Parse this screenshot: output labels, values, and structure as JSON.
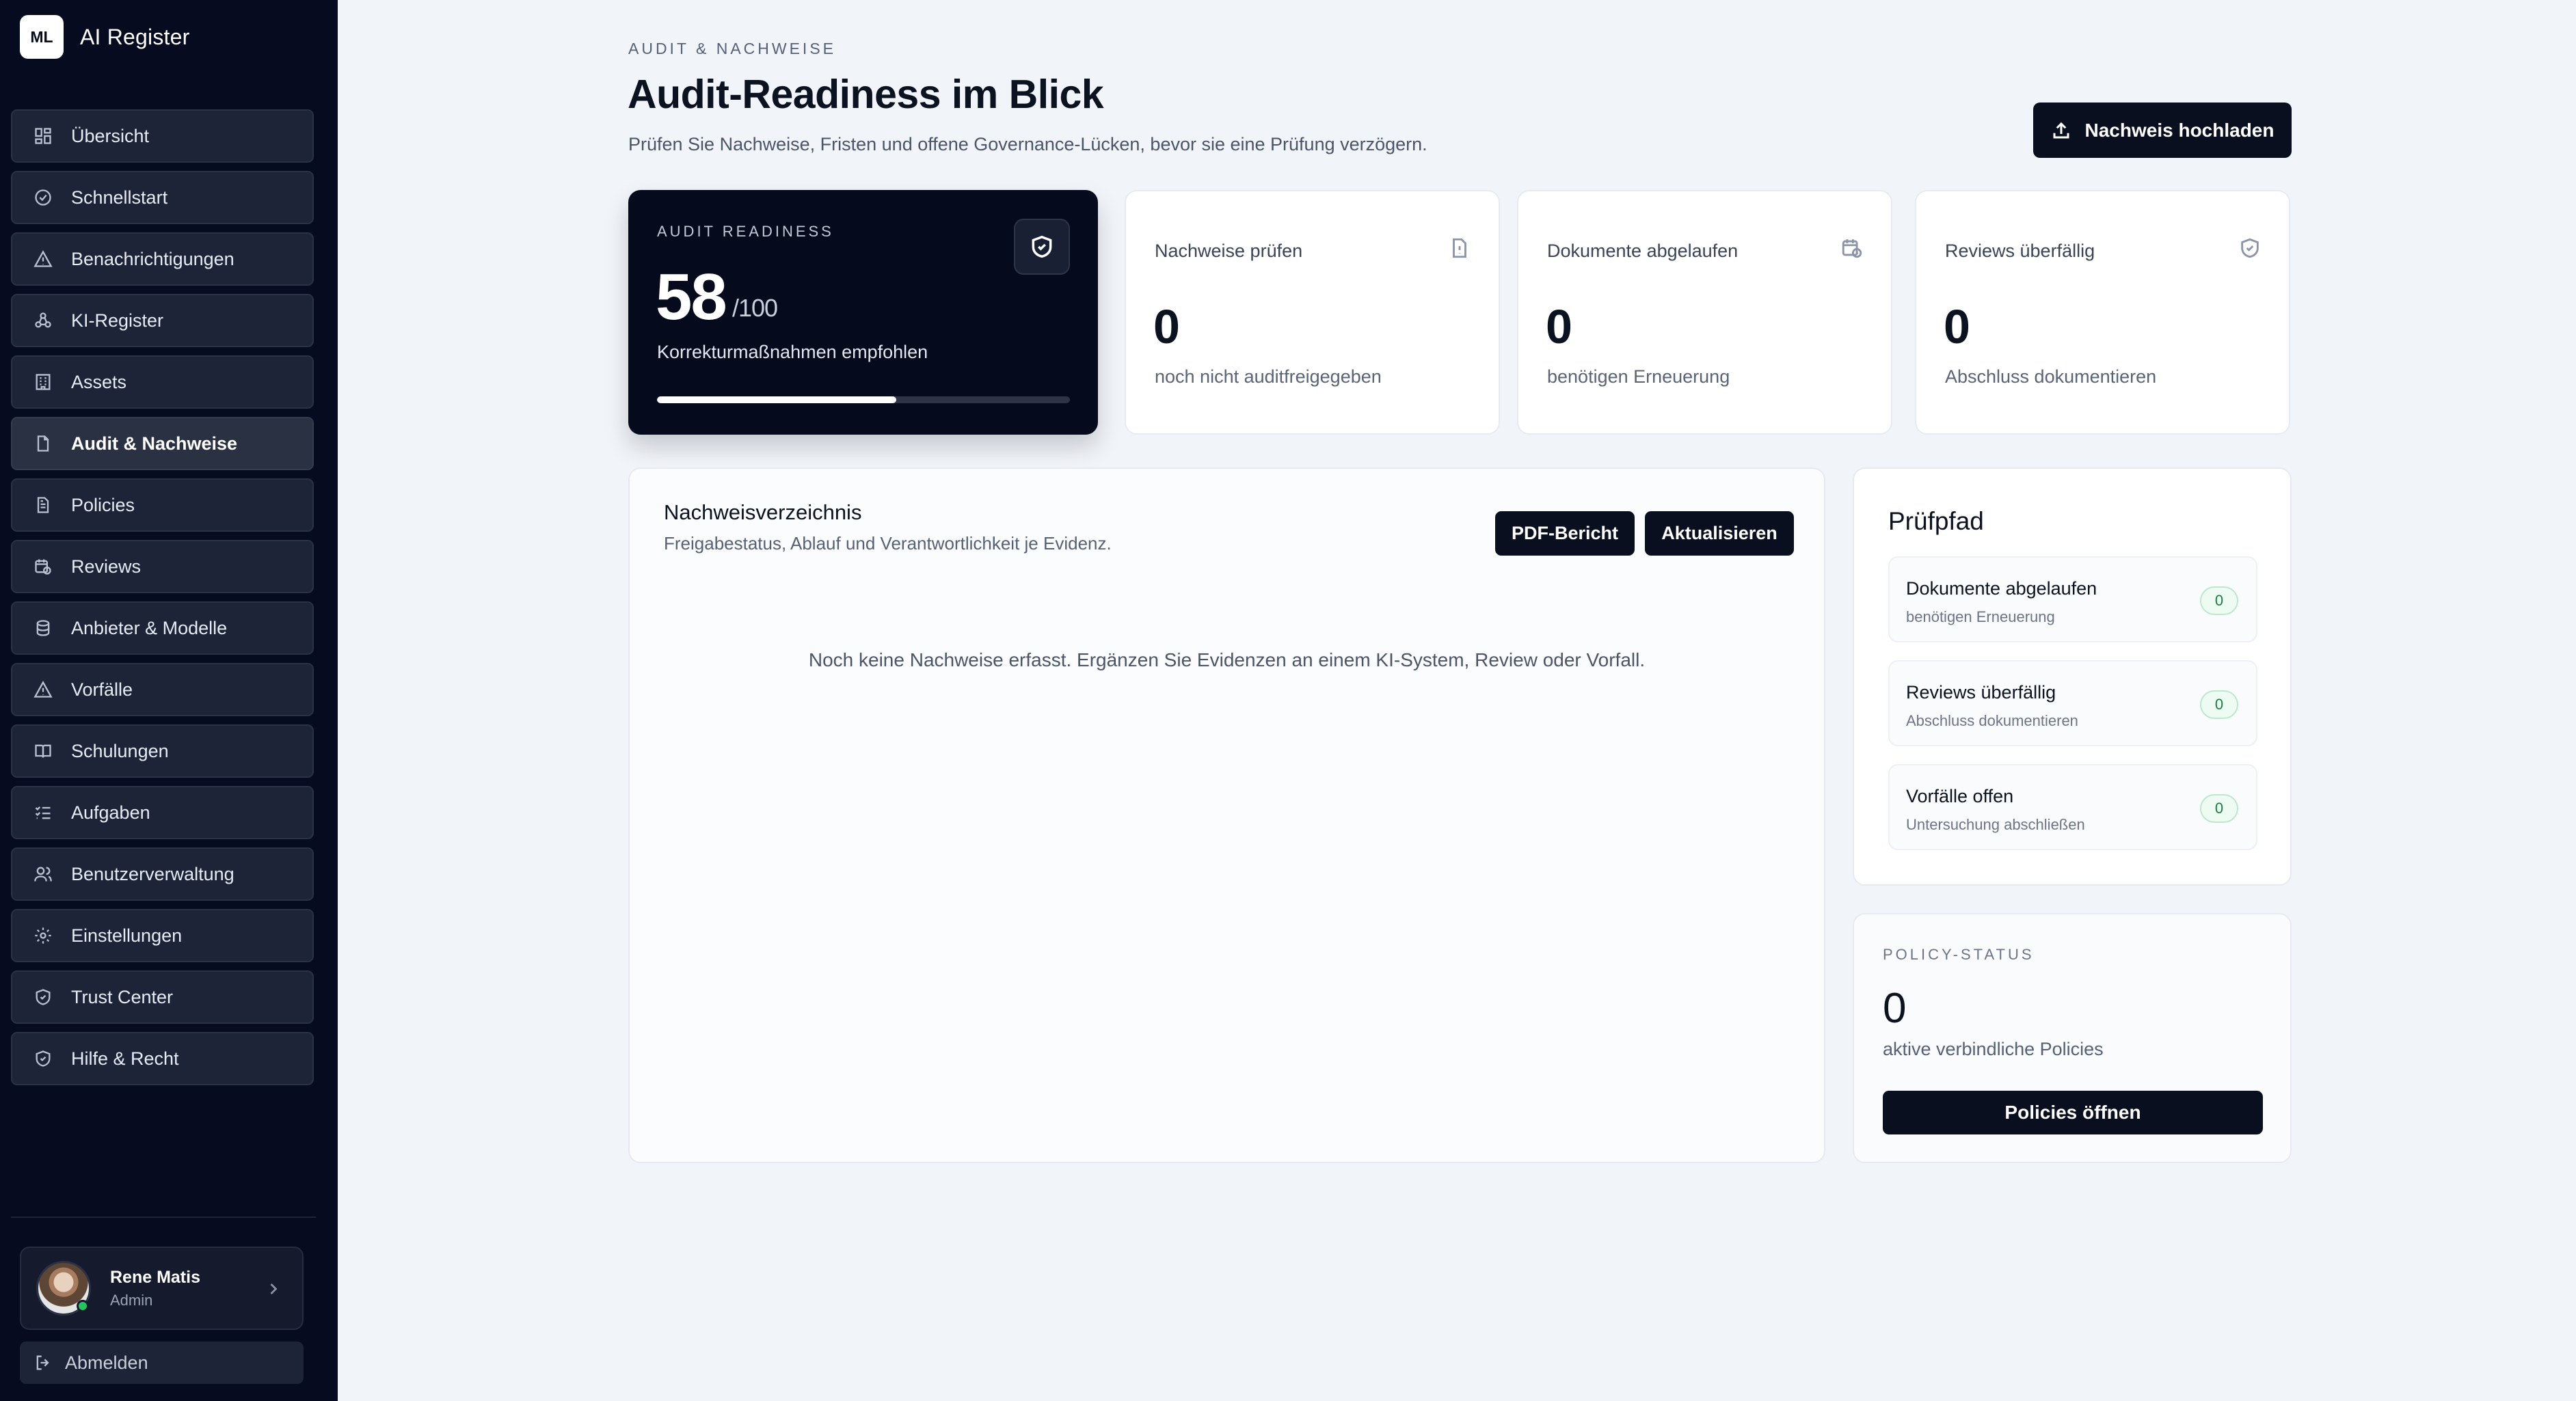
{
  "app": {
    "logo_text": "ML",
    "name": "AI Register"
  },
  "sidebar": {
    "items": [
      {
        "label": "Übersicht",
        "icon": "grid-icon",
        "active": false
      },
      {
        "label": "Schnellstart",
        "icon": "check-circle-icon",
        "active": false
      },
      {
        "label": "Benachrichtigungen",
        "icon": "alert-triangle-icon",
        "active": false
      },
      {
        "label": "KI-Register",
        "icon": "network-icon",
        "active": false
      },
      {
        "label": "Assets",
        "icon": "building-icon",
        "active": false
      },
      {
        "label": "Audit & Nachweise",
        "icon": "file-icon",
        "active": true
      },
      {
        "label": "Policies",
        "icon": "document-icon",
        "active": false
      },
      {
        "label": "Reviews",
        "icon": "calendar-clock-icon",
        "active": false
      },
      {
        "label": "Anbieter & Modelle",
        "icon": "database-icon",
        "active": false
      },
      {
        "label": "Vorfälle",
        "icon": "alert-triangle-icon",
        "active": false
      },
      {
        "label": "Schulungen",
        "icon": "book-open-icon",
        "active": false
      },
      {
        "label": "Aufgaben",
        "icon": "list-checks-icon",
        "active": false
      },
      {
        "label": "Benutzerverwaltung",
        "icon": "users-icon",
        "active": false
      },
      {
        "label": "Einstellungen",
        "icon": "gear-icon",
        "active": false
      },
      {
        "label": "Trust Center",
        "icon": "shield-check-icon",
        "active": false
      },
      {
        "label": "Hilfe & Recht",
        "icon": "shield-icon",
        "active": false
      }
    ],
    "user": {
      "name": "Rene Matis",
      "role": "Admin",
      "online": true
    },
    "logout_label": "Abmelden"
  },
  "header": {
    "eyebrow": "AUDIT & NACHWEISE",
    "title": "Audit-Readiness im Blick",
    "subtitle": "Prüfen Sie Nachweise, Fristen und offene Governance-Lücken, bevor sie eine Prüfung verzögern.",
    "upload_label": "Nachweis hochladen"
  },
  "readiness": {
    "label": "AUDIT READINESS",
    "score": "58",
    "max": "/100",
    "note": "Korrekturmaßnahmen empfohlen",
    "progress": 0.58
  },
  "stats": [
    {
      "title": "Nachweise prüfen",
      "value": "0",
      "note": "noch nicht auditfreigegeben",
      "icon": "file-alert-icon"
    },
    {
      "title": "Dokumente abgelaufen",
      "value": "0",
      "note": "benötigen Erneuerung",
      "icon": "calendar-clock-icon"
    },
    {
      "title": "Reviews überfällig",
      "value": "0",
      "note": "Abschluss dokumentieren",
      "icon": "shield-icon"
    }
  ],
  "evidence": {
    "title": "Nachweisverzeichnis",
    "subtitle": "Freigabestatus, Ablauf und Verantwortlichkeit je Evidenz.",
    "pdf_label": "PDF-Bericht",
    "refresh_label": "Aktualisieren",
    "empty_text": "Noch keine Nachweise erfasst. Ergänzen Sie Evidenzen an einem KI-System, Review oder Vorfall."
  },
  "audit_path": {
    "title": "Prüfpfad",
    "items": [
      {
        "title": "Dokumente abgelaufen",
        "sub": "benötigen Erneuerung",
        "count": "0"
      },
      {
        "title": "Reviews überfällig",
        "sub": "Abschluss dokumentieren",
        "count": "0"
      },
      {
        "title": "Vorfälle offen",
        "sub": "Untersuchung abschließen",
        "count": "0"
      }
    ]
  },
  "policy_status": {
    "label": "POLICY-STATUS",
    "value": "0",
    "note": "aktive verbindliche Policies",
    "button_label": "Policies öffnen"
  },
  "colors": {
    "sidebar_bg": "#060b1f",
    "accent_dark": "#0a0f1f",
    "badge_green": "#16803d",
    "page_bg": "#f1f4f8"
  }
}
